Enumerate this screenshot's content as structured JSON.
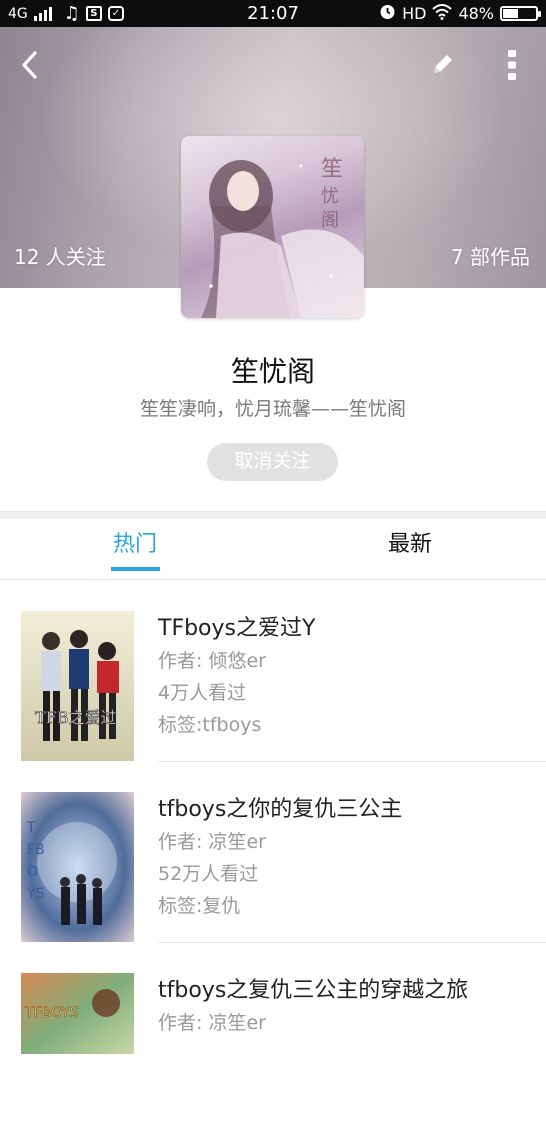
{
  "status_bar": {
    "network": "4G",
    "time": "21:07",
    "hd": "HD",
    "battery": "48%",
    "battery_level": 0.48
  },
  "header": {
    "followers": "12 人关注",
    "works": "7 部作品"
  },
  "profile": {
    "name": "笙忧阁",
    "description": "笙笙凄响，忧月琉馨——笙忧阁",
    "unfollow_label": "取消关注"
  },
  "tabs": [
    {
      "label": "热门",
      "active": true
    },
    {
      "label": "最新",
      "active": false
    }
  ],
  "books": [
    {
      "title": "TFboys之爱过Y",
      "author": "作者: 倾悠er",
      "views": "4万人看过",
      "tags": "标签:tfboys"
    },
    {
      "title": "tfboys之你的复仇三公主",
      "author": "作者: 凉笙er",
      "views": "52万人看过",
      "tags": "标签:复仇"
    },
    {
      "title": "tfboys之复仇三公主的穿越之旅",
      "author": "作者: 凉笙er",
      "views": "",
      "tags": ""
    }
  ],
  "colors": {
    "accent": "#29a4dd",
    "status_bar_bg": "#0d0d0d",
    "button_bg": "#dfe2e0"
  },
  "icons": {
    "back": "chevron-left-icon",
    "edit": "pencil-icon",
    "more": "more-vertical-icon"
  }
}
